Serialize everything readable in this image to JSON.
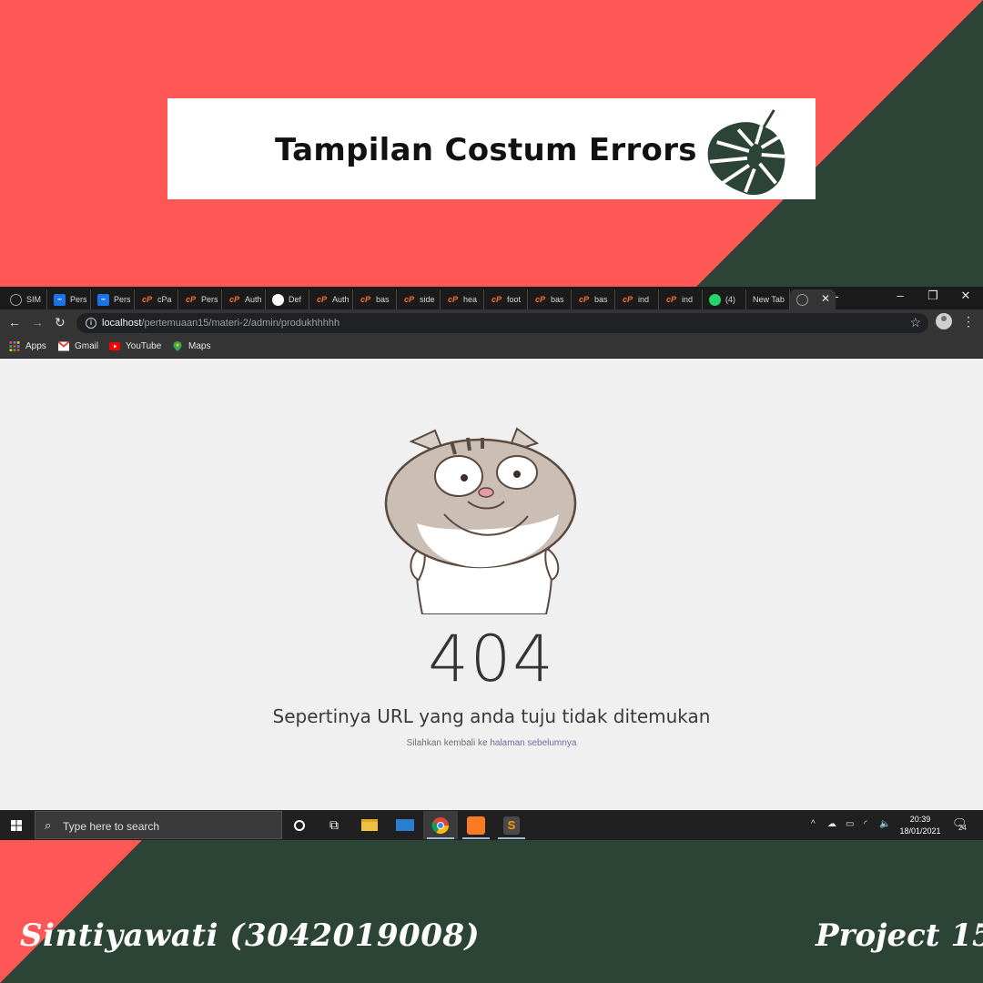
{
  "colors": {
    "coral": "#ff5656",
    "forest": "#2c4436",
    "white": "#ffffff"
  },
  "banner": {
    "title": "Tampilan Costum Errors",
    "leaf_icon": "monstera-leaf-icon"
  },
  "browser": {
    "tabs": [
      {
        "label": "SIM",
        "icon": "globe-icon"
      },
      {
        "label": "Pers",
        "icon": "app-icon"
      },
      {
        "label": "Pers",
        "icon": "app-icon"
      },
      {
        "label": "cPa",
        "icon": "cpanel-icon"
      },
      {
        "label": "Pers",
        "icon": "cpanel-icon"
      },
      {
        "label": "Auth",
        "icon": "cpanel-icon"
      },
      {
        "label": "Def",
        "icon": "github-icon"
      },
      {
        "label": "Auth",
        "icon": "cpanel-icon"
      },
      {
        "label": "bas",
        "icon": "cpanel-icon"
      },
      {
        "label": "side",
        "icon": "cpanel-icon"
      },
      {
        "label": "hea",
        "icon": "cpanel-icon"
      },
      {
        "label": "foot",
        "icon": "cpanel-icon"
      },
      {
        "label": "bas",
        "icon": "cpanel-icon"
      },
      {
        "label": "bas",
        "icon": "cpanel-icon"
      },
      {
        "label": "ind",
        "icon": "cpanel-icon"
      },
      {
        "label": "ind",
        "icon": "cpanel-icon"
      },
      {
        "label": "(4)",
        "icon": "whatsapp-icon"
      },
      {
        "label": "New Tab",
        "icon": ""
      },
      {
        "label": "",
        "icon": "globe-icon",
        "active": true
      }
    ],
    "new_tab": "+",
    "window_controls": {
      "minimize": "–",
      "restore": "❐",
      "close": "✕"
    },
    "url_host": "localhost",
    "url_path": "/pertemuaan15/materi-2/admin/produkhhhhh",
    "bookmarks": [
      {
        "label": "Apps",
        "icon": "apps-grid-icon"
      },
      {
        "label": "Gmail",
        "icon": "gmail-icon"
      },
      {
        "label": "YouTube",
        "icon": "youtube-icon"
      },
      {
        "label": "Maps",
        "icon": "maps-pin-icon"
      }
    ]
  },
  "page": {
    "code": "404",
    "message": "Sepertinya URL yang anda tuju tidak ditemukan",
    "hint_prefix": "Silahkan kembali ke ",
    "hint_link": "halaman sebelumnya",
    "illustration": "cartoon-cat-icon"
  },
  "taskbar": {
    "search_placeholder": "Type here to search",
    "time": "20:39",
    "date": "18/01/2021",
    "notification_count": "24"
  },
  "footer": {
    "author": "Sintiyawati (3042019008)",
    "project": "Project 15"
  }
}
